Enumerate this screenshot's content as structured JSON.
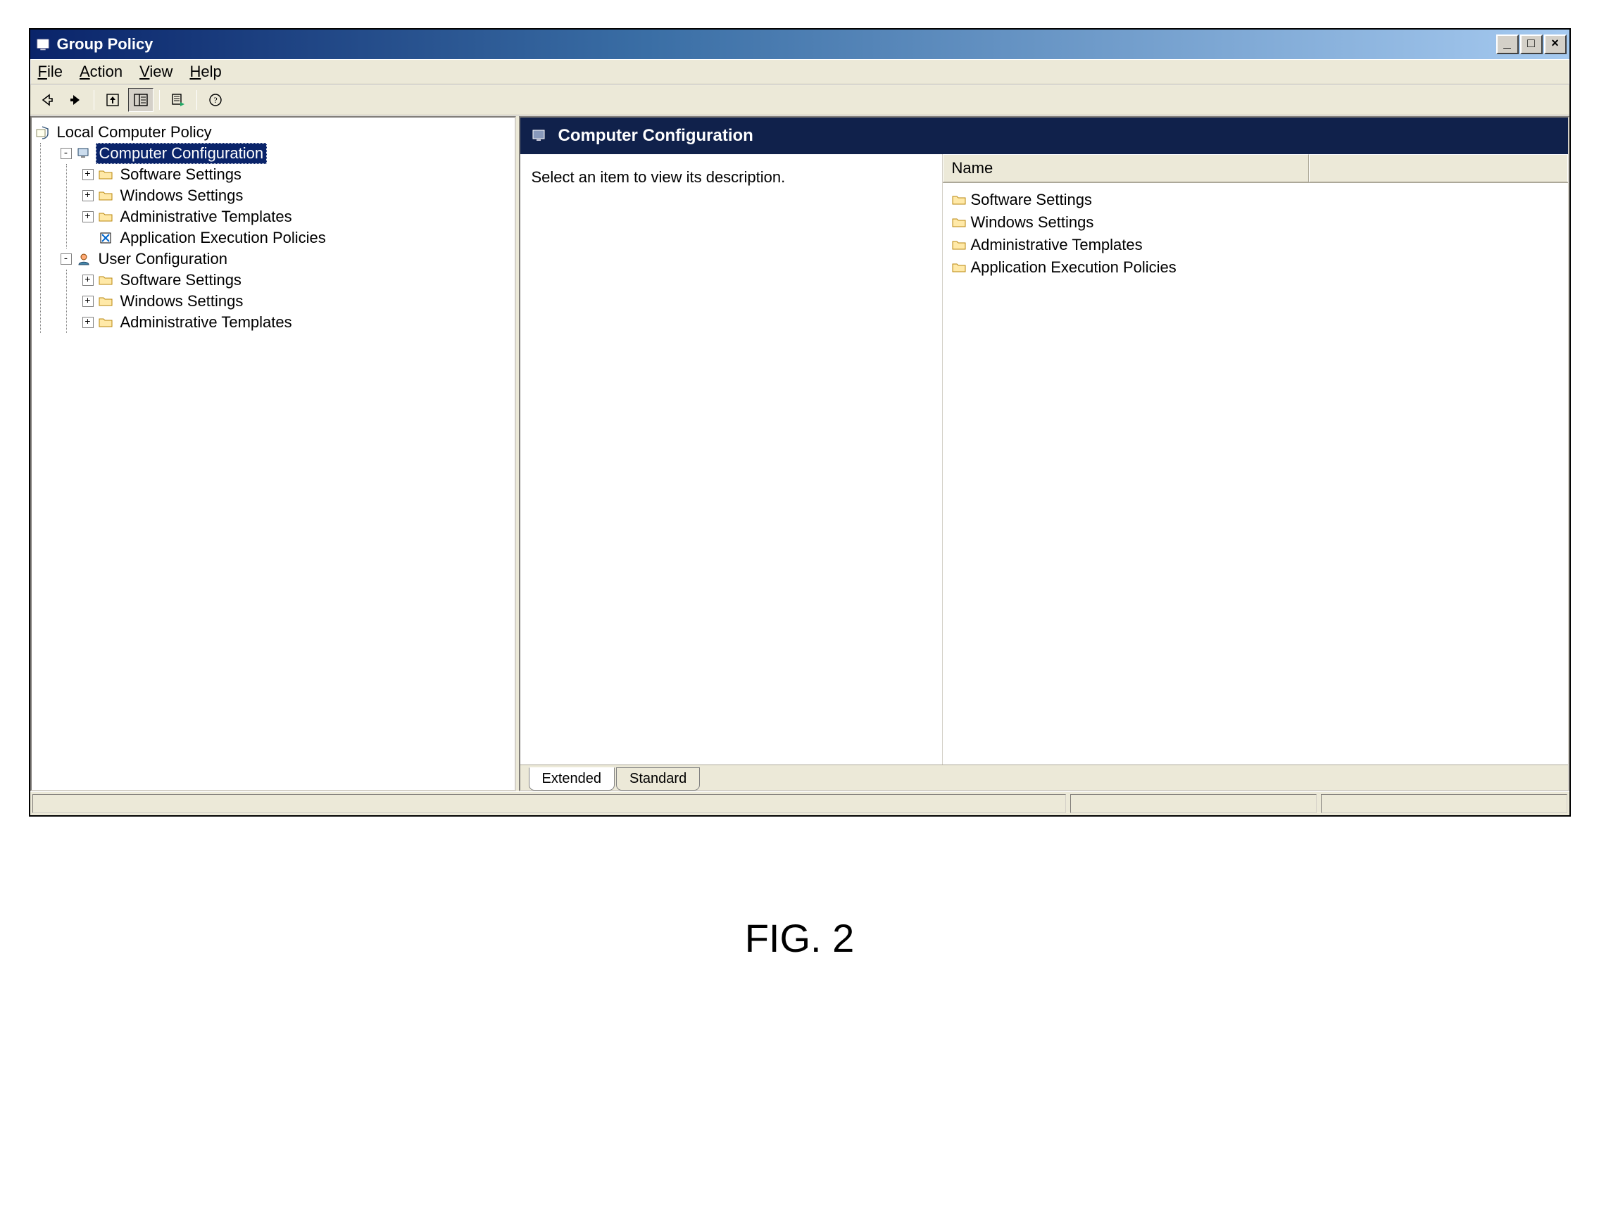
{
  "window": {
    "title": "Group Policy"
  },
  "menu": {
    "file": "File",
    "action": "Action",
    "view": "View",
    "help": "Help"
  },
  "tree": {
    "root": "Local Computer Policy",
    "comp_config": "Computer Configuration",
    "comp_children": {
      "software": "Software Settings",
      "windows": "Windows Settings",
      "admin": "Administrative Templates",
      "appexec": "Application Execution Policies"
    },
    "user_config": "User Configuration",
    "user_children": {
      "software": "Software Settings",
      "windows": "Windows Settings",
      "admin": "Administrative Templates"
    }
  },
  "detail": {
    "header": "Computer Configuration",
    "description": "Select an item to view its description.",
    "column_name": "Name",
    "items": [
      "Software Settings",
      "Windows Settings",
      "Administrative Templates",
      "Application Execution Policies"
    ]
  },
  "tabs": {
    "extended": "Extended",
    "standard": "Standard"
  },
  "caption": "FIG. 2"
}
